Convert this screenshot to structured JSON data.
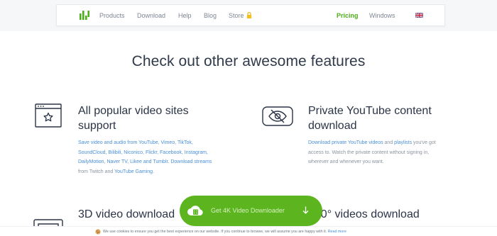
{
  "nav": {
    "items": [
      "Products",
      "Download",
      "Help",
      "Blog",
      "Store"
    ],
    "pricing": "Pricing",
    "platform": "Windows",
    "accent": "#4caf1c"
  },
  "heading": "Check out other awesome features",
  "features": [
    {
      "title_line1": "All popular video sites",
      "title_line2": "support",
      "icon": "browser-star-icon",
      "desc": {
        "l1a": "Save video and audio from YouTube, Vimeo, TikTok,",
        "l2a": "SoundCloud, Bilibili, Niconico, Flickr, Facebook, Instagram,",
        "l3a": "DailyMotion, Naver TV, Likee and Tumblr. Download streams",
        "l4a": "from Twitch and ",
        "l4link": "YouTube Gaming",
        "l4b": "."
      }
    },
    {
      "title_line1": "Private YouTube content",
      "title_line2": "download",
      "icon": "hidden-eye-icon",
      "desc": {
        "l1link1": "Download private YouTube videos",
        "l1mid": " and ",
        "l1link2": "playlists",
        "l1b": " you've got",
        "l2a": "access to. Watch the private content without signing in,",
        "l3a": "wherever and whenever you want."
      }
    },
    {
      "title_line1": "3D video download",
      "icon": "3d-video-icon"
    },
    {
      "title_line1": "360° videos download"
    }
  ],
  "download_button": {
    "label": "Get 4K Video Downloader",
    "icon": "film-cloud-icon",
    "color": "#5cb51e"
  },
  "cookie": {
    "text": "We use cookies to ensure you get the best experience on our website. If you continue to browse, we will assume you are happy with it.",
    "link": "Read more",
    "icon": "cookie-icon"
  }
}
